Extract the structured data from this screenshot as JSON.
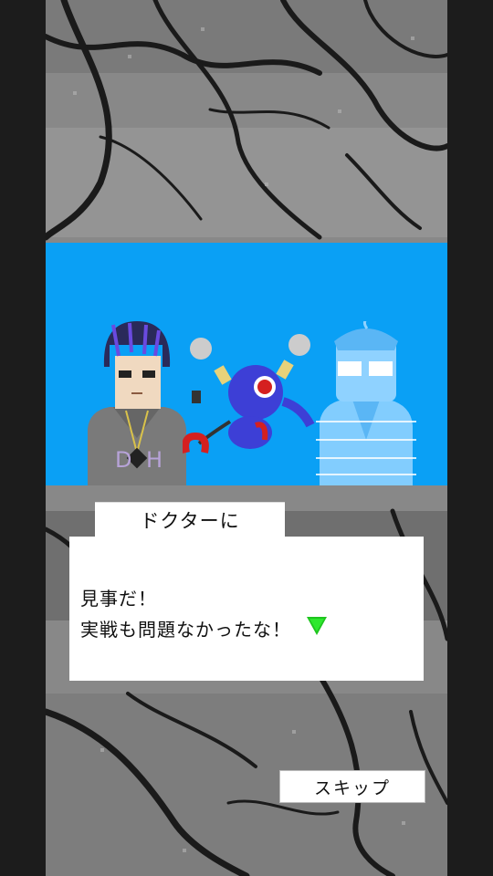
{
  "dialog": {
    "speaker": "ドクターに",
    "lines": [
      "見事だ！",
      "実戦も問題なかったな！"
    ]
  },
  "controls": {
    "skip_label": "スキップ"
  },
  "scene": {
    "background_color": "#0aa0f5",
    "characters": [
      "boy-character",
      "robot-character",
      "doctor-hologram"
    ]
  },
  "icons": {
    "next": "next-arrow-icon"
  },
  "colors": {
    "next_arrow": "#1fc51f",
    "hologram": "#8fd2ff",
    "robot": "#3d3fd6"
  }
}
